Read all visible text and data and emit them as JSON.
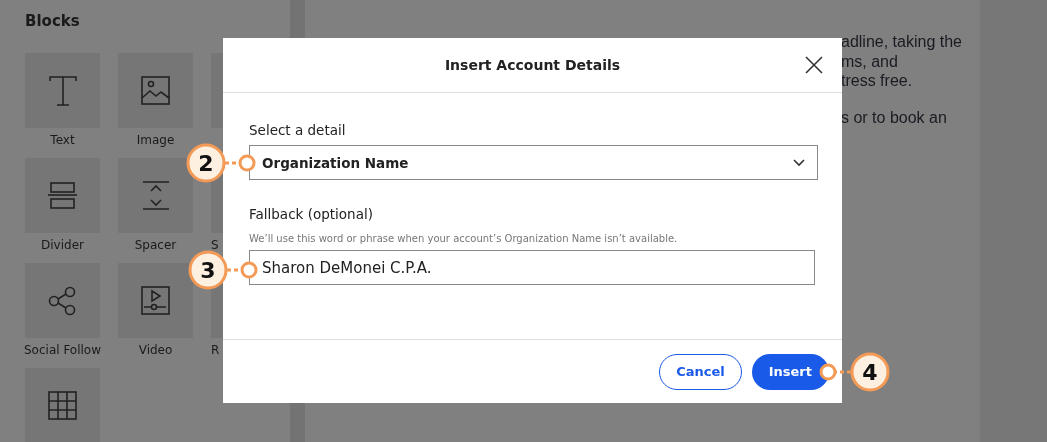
{
  "sidebar": {
    "title": "Blocks",
    "blocks": [
      {
        "kind": "text",
        "label": "Text"
      },
      {
        "kind": "image",
        "label": "Image"
      },
      {
        "kind": "hidden"
      },
      {
        "kind": "divider",
        "label": "Divider"
      },
      {
        "kind": "spacer",
        "label": "Spacer"
      },
      {
        "kind": "hidden",
        "label": "S"
      },
      {
        "kind": "social",
        "label": "Social Follow"
      },
      {
        "kind": "video",
        "label": "Video"
      },
      {
        "kind": "hidden",
        "label": "R"
      },
      {
        "kind": "table"
      }
    ]
  },
  "content": {
    "paragraphs": [
      [
        "adline, taking the",
        "ms, and",
        "tress free."
      ],
      [
        "s or to book an"
      ]
    ]
  },
  "dialog": {
    "title": "Insert Account Details",
    "select": {
      "label": "Select a detail",
      "value": "Organization Name"
    },
    "fallback": {
      "label": "Fallback (optional)",
      "hint": "We’ll use this word or phrase when your account’s Organization Name isn’t available.",
      "value": "Sharon DeMonei C.P.A."
    },
    "buttons": [
      {
        "kind": "secondary",
        "label": "Cancel"
      },
      {
        "kind": "primary",
        "label": "Insert"
      }
    ]
  },
  "callouts": [
    {
      "number": "2"
    },
    {
      "number": "3"
    },
    {
      "number": "4"
    }
  ]
}
